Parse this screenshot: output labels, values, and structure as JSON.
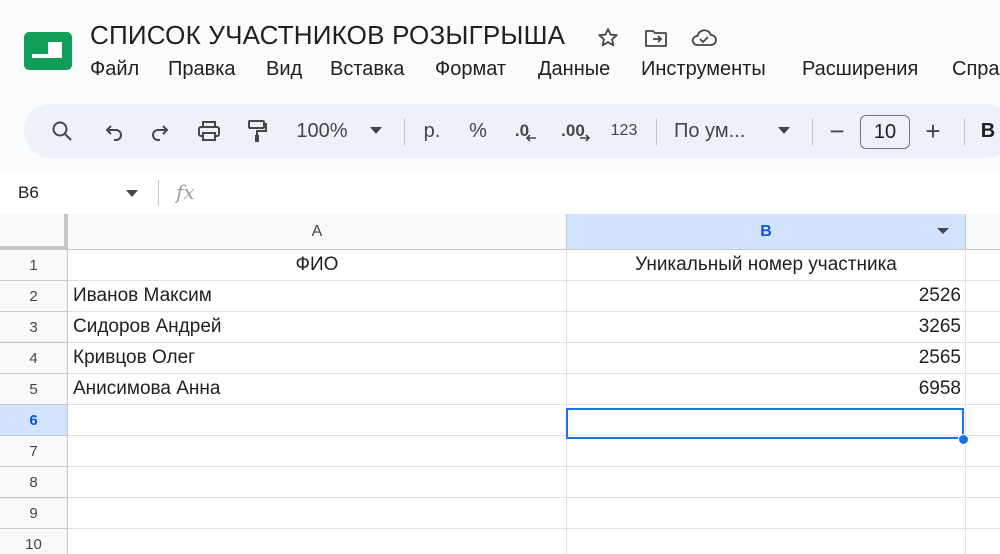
{
  "document": {
    "title": "СПИСОК УЧАСТНИКОВ РОЗЫГРЫША",
    "brand_color": "#0f9d58"
  },
  "menu": [
    "Файл",
    "Правка",
    "Вид",
    "Вставка",
    "Формат",
    "Данные",
    "Инструменты",
    "Расширения",
    "Спра"
  ],
  "toolbar": {
    "zoom": "100%",
    "currency": "р.",
    "percent": "%",
    "decrease_decimals": ".0",
    "increase_decimals": ".00",
    "number_format": "123",
    "font": "По ум...",
    "font_size": "10",
    "bold": "B",
    "minus": "−",
    "plus": "+"
  },
  "formula_bar": {
    "cell_ref": "B6",
    "fx": "fx",
    "value": ""
  },
  "grid": {
    "columns": [
      "A",
      "B"
    ],
    "selected_column": "B",
    "rows": [
      {
        "num": "1",
        "a": "ФИО",
        "b": "Уникальный номер участника"
      },
      {
        "num": "2",
        "a": "Иванов Максим",
        "b": "2526"
      },
      {
        "num": "3",
        "a": "Сидоров Андрей",
        "b": "3265"
      },
      {
        "num": "4",
        "a": "Кривцов Олег",
        "b": "2565"
      },
      {
        "num": "5",
        "a": "Анисимова Анна",
        "b": "6958"
      },
      {
        "num": "6",
        "a": "",
        "b": ""
      },
      {
        "num": "7",
        "a": "",
        "b": ""
      },
      {
        "num": "8",
        "a": "",
        "b": ""
      },
      {
        "num": "9",
        "a": "",
        "b": ""
      },
      {
        "num": "10",
        "a": "",
        "b": ""
      }
    ],
    "selected_cell": "B6",
    "selected_row": "6"
  },
  "colors": {
    "selection": "#1a73e8",
    "selected_header_bg": "#d3e3fd",
    "toolbar_bg": "#edf2fa"
  },
  "icons": [
    "sheets-logo-icon",
    "star-icon",
    "move-to-folder-icon",
    "cloud-saved-icon",
    "search-icon",
    "undo-icon",
    "redo-icon",
    "print-icon",
    "paint-format-icon",
    "chevron-down-icon"
  ]
}
